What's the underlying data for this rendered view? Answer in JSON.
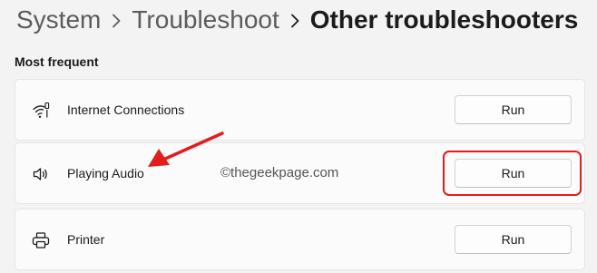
{
  "breadcrumb": {
    "items": [
      "System",
      "Troubleshoot"
    ],
    "current": "Other troubleshooters"
  },
  "section": {
    "label": "Most frequent"
  },
  "troubleshooters": [
    {
      "label": "Internet Connections",
      "icon": "wifi-icon",
      "button_label": "Run"
    },
    {
      "label": "Playing Audio",
      "icon": "speaker-icon",
      "button_label": "Run",
      "highlighted": true
    },
    {
      "label": "Printer",
      "icon": "printer-icon",
      "button_label": "Run"
    }
  ],
  "watermark": "©thegeekpage.com",
  "annotation_color": "#e11d1d"
}
